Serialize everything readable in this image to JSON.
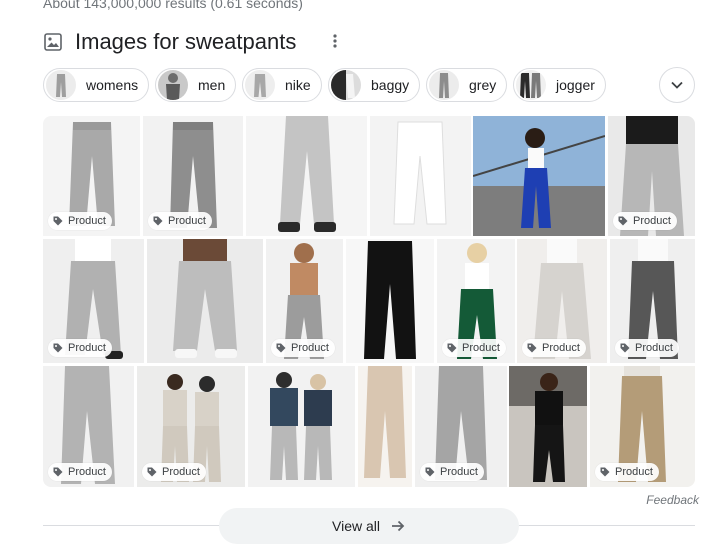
{
  "results": {
    "count_text": "About 143,000,000 results (0.61 seconds)"
  },
  "section": {
    "title": "Images for sweatpants",
    "icon": "image-icon",
    "more_icon": "more-vert-icon"
  },
  "chips": [
    {
      "label": "womens"
    },
    {
      "label": "men"
    },
    {
      "label": "nike"
    },
    {
      "label": "baggy"
    },
    {
      "label": "grey"
    },
    {
      "label": "jogger"
    }
  ],
  "chips_expand": {
    "icon": "chevron-down-icon"
  },
  "badge": {
    "label": "Product",
    "icon": "tag-icon"
  },
  "images": [
    {
      "description": "grey sweatpants flat",
      "badge": true
    },
    {
      "description": "heather grey sweatpants flat",
      "badge": true
    },
    {
      "description": "person wearing grey joggers",
      "badge": false
    },
    {
      "description": "white sweatpants flat",
      "badge": false
    },
    {
      "description": "woman in blue sweatpants on bridge",
      "badge": false
    },
    {
      "description": "grey sweatpants worn with black top",
      "badge": true
    },
    {
      "description": "woman in grey sweatpants",
      "badge": true
    },
    {
      "description": "grey joggers with sneakers",
      "badge": false
    },
    {
      "description": "shirtless man in grey sweatpants",
      "badge": true
    },
    {
      "description": "black sweatpants",
      "badge": false
    },
    {
      "description": "woman in green sweatpants",
      "badge": true
    },
    {
      "description": "woman in light grey sweatpants",
      "badge": true
    },
    {
      "description": "charcoal sweatpants",
      "badge": true
    },
    {
      "description": "grey wide leg sweatpants",
      "badge": true
    },
    {
      "description": "couple in beige sweatsuits",
      "badge": true
    },
    {
      "description": "couple in grey sweatpants",
      "badge": false
    },
    {
      "description": "beige joggers",
      "badge": false
    },
    {
      "description": "grey sweatpants with sneakers",
      "badge": true
    },
    {
      "description": "woman in black sweatpants outfit",
      "badge": false
    },
    {
      "description": "khaki joggers",
      "badge": true
    }
  ],
  "feedback": {
    "label": "Feedback"
  },
  "view_all": {
    "label": "View all",
    "icon": "arrow-right-icon"
  },
  "colors": {
    "accent": "#1a73e8",
    "chip_border": "#dadce0",
    "text_muted": "#70757a"
  }
}
